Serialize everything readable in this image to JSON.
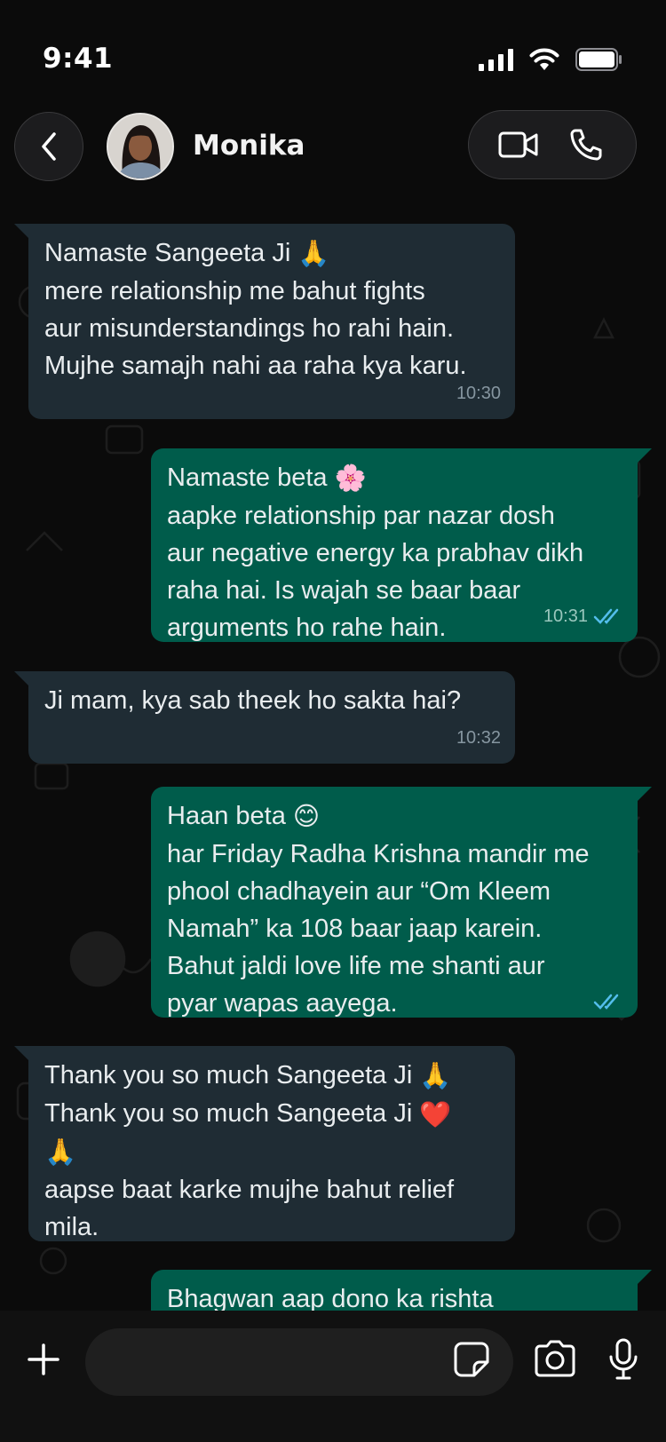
{
  "status_bar": {
    "time": "9:41"
  },
  "header": {
    "contact_name": "Monika",
    "back_icon": "chevron-left-icon",
    "video_icon": "video-call-icon",
    "call_icon": "phone-icon"
  },
  "messages": [
    {
      "direction": "incoming",
      "lines": [
        "Namaste Sangeeta Ji",
        "mere relationship me bahut fights",
        "aur misunderstandings ho rahi hain.",
        "Mujhe samajh nahi aa raha kya karu."
      ],
      "time": "10:30",
      "emoji": "🙏"
    },
    {
      "direction": "outgoing",
      "lines": [
        "Namaste beta",
        "aapke relationship par nazar dosh",
        "aur negative energy ka prabhav dikh",
        "raha hai. Is wajah se baar baar",
        "arguments ho rahe hain."
      ],
      "time": "10:31",
      "emoji": "🌸",
      "read": true
    },
    {
      "direction": "incoming",
      "lines": [
        "Ji mam, kya sab theek ho sakta hai?"
      ],
      "time": "10:32"
    },
    {
      "direction": "outgoing",
      "lines": [
        "Haan beta",
        "har Friday Radha Krishna mandir me",
        "phool chadhayein aur “Om Kleem",
        "Namah” ka 108 baar jaap karein.",
        "Bahut jaldi love life me shanti aur",
        "pyar wapas aayega."
      ],
      "time": "",
      "emoji": "😊",
      "read": true
    },
    {
      "direction": "incoming",
      "lines": [
        "Thank you so much Sangeeta Ji",
        "Thank you so much Sangeeta Ji",
        "🙏",
        "aapse baat karke mujhe bahut relief",
        "mila."
      ],
      "time": "",
      "emoji": "🙏",
      "emoji2": "❤️"
    },
    {
      "direction": "outgoing",
      "lines": [
        "Bhagwan aap dono ka rishta"
      ],
      "time": ""
    }
  ],
  "input_bar": {
    "placeholder": "",
    "plus_icon": "plus-icon",
    "sticker_icon": "sticker-icon",
    "camera_icon": "camera-icon",
    "mic_icon": "microphone-icon"
  },
  "colors": {
    "incoming_bubble": "#1f2c34",
    "outgoing_bubble": "#005c4b",
    "read_ticks": "#53bdeb",
    "background": "#0b0b0b"
  }
}
